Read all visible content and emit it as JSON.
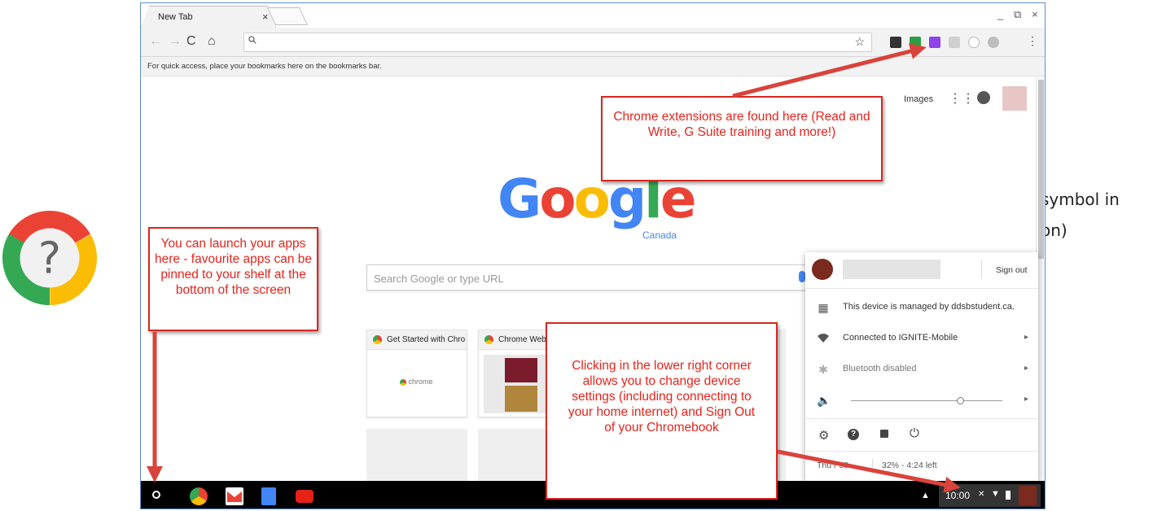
{
  "browser": {
    "tab_title": "New Tab",
    "tab_close": "×",
    "window_controls": [
      "_",
      "⧉",
      "×"
    ],
    "bookmarks_hint": "For quick access, place your bookmarks here on the bookmarks bar.",
    "omnibox_icon": "search-icon",
    "star_icon": "☆",
    "menu_icon": "⋮"
  },
  "ntp": {
    "images_link": "Images",
    "google_letters": [
      "G",
      "o",
      "o",
      "g",
      "l",
      "e"
    ],
    "google_colors": [
      "#4285f4",
      "#ea4335",
      "#fbbc05",
      "#4285f4",
      "#34a853",
      "#ea4335"
    ],
    "region": "Canada",
    "search_placeholder": "Search Google or type URL",
    "tiles": [
      {
        "title": "Get Started with Chro",
        "body": "chrome"
      },
      {
        "title": "Chrome Web",
        "body": ""
      }
    ]
  },
  "tray": {
    "sign_out": "Sign out",
    "managed": "This device is managed by ddsbstudent.ca.",
    "network": "Connected to IGNITE-Mobile",
    "bluetooth": "Bluetooth disabled",
    "date_fragment": "Thu  r 30",
    "battery": "32% - 4:24 left",
    "volume_level": 0.72
  },
  "shelf": {
    "time": "10:00"
  },
  "side_text": {
    "line1": "symbol in",
    "line2": "on)"
  },
  "callouts": {
    "extensions": "Chrome extensions are found here (Read and Write, G Suite training and more!)",
    "launcher": "You can launch your apps here - favourite apps can be pinned to your shelf at the bottom of the screen",
    "settings": "Clicking in the lower right corner allows you to change device settings (including connecting to your home internet) and Sign Out of your Chromebook"
  },
  "colors": {
    "callout_red": "#e8231b",
    "arrow_red": "#d9433b",
    "frame_blue": "#5b8fd8"
  }
}
